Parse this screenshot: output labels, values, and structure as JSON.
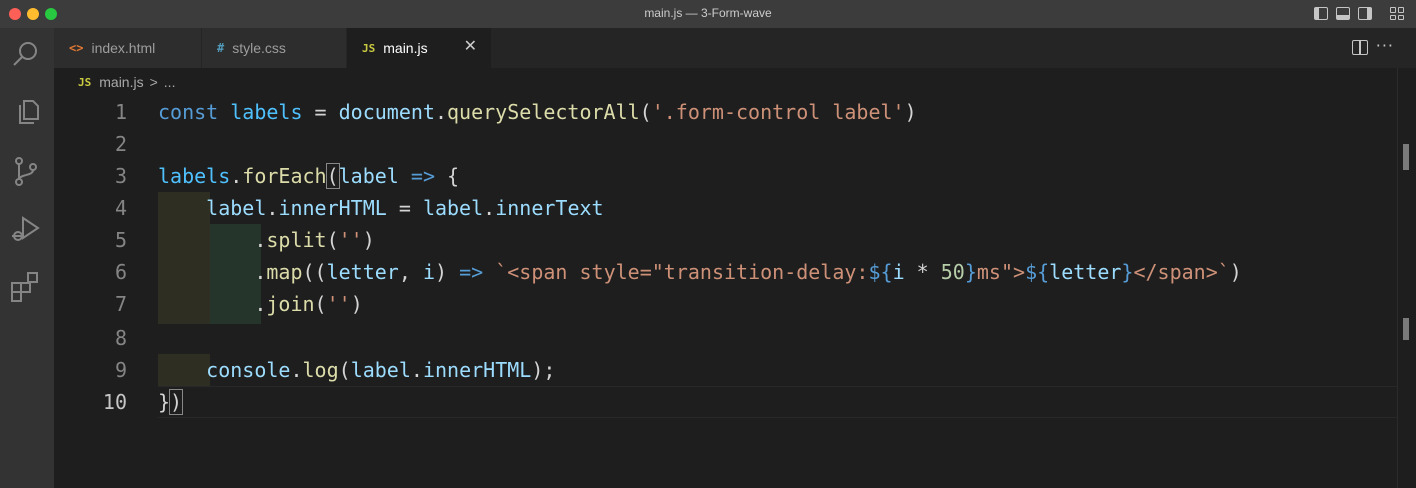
{
  "window": {
    "title": "main.js — 3-Form-wave"
  },
  "tabs": [
    {
      "label": "index.html",
      "icon": "<>"
    },
    {
      "label": "style.css",
      "icon": "#"
    },
    {
      "label": "main.js",
      "icon": "JS"
    }
  ],
  "breadcrumb": {
    "icon": "JS",
    "file": "main.js",
    "sep": ">",
    "rest": "..."
  },
  "editor": {
    "line_numbers": [
      "1",
      "2",
      "3",
      "4",
      "5",
      "6",
      "7",
      "8",
      "9",
      "10"
    ],
    "current_line": "10",
    "lines": {
      "l1": {
        "const": "const",
        "labels": "labels",
        "eq": " = ",
        "document": "document",
        "dot": ".",
        "qsa": "querySelectorAll",
        "open": "(",
        "str": "'.form-control label'",
        "close": ")"
      },
      "l3": {
        "labels": "labels",
        "dot": ".",
        "forEach": "forEach",
        "paren": "(",
        "label": "label",
        "arrow": " => ",
        "brace": "{"
      },
      "l4": {
        "label": "label",
        "dot": ".",
        "innerHTML": "innerHTML",
        "eq": " = ",
        "label2": "label",
        "dot2": ".",
        "innerText": "innerText"
      },
      "l5": {
        "dot": ".",
        "split": "split",
        "open": "(",
        "str": "''",
        "close": ")"
      },
      "l6": {
        "dot": ".",
        "map": "map",
        "open": "((",
        "letter": "letter",
        "comma": ", ",
        "i": "i",
        "close": ")",
        "arrow": " => ",
        "tpl1": "`<span style=\"transition-delay:",
        "d1": "${",
        "i2": "i",
        "mul": " * ",
        "num": "50",
        "d1c": "}",
        "tpl2": "ms\">",
        "d2": "${",
        "letter2": "letter",
        "d2c": "}",
        "tpl3": "</span>`",
        "end": ")"
      },
      "l7": {
        "dot": ".",
        "join": "join",
        "open": "(",
        "str": "''",
        "close": ")"
      },
      "l9": {
        "console": "console",
        "dot": ".",
        "log": "log",
        "open": "(",
        "label": "label",
        "dot2": ".",
        "innerHTML": "innerHTML",
        "close": ");"
      },
      "l10": {
        "brace": "}",
        "paren": ")"
      }
    }
  },
  "toolbar": {
    "close_glyph": "✕",
    "more_glyph": "···"
  }
}
